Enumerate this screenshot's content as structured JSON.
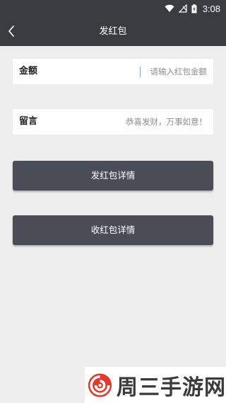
{
  "status_bar": {
    "time": "3:08",
    "icons": [
      "wifi-icon",
      "no-signal-icon",
      "battery-charging-icon"
    ]
  },
  "nav": {
    "title": "发红包",
    "back_icon": "chevron-left-icon"
  },
  "amount_field": {
    "label": "金额",
    "placeholder": "请输入红包金额",
    "value": ""
  },
  "message_field": {
    "label": "留言",
    "placeholder": "恭喜发财，万事如意！",
    "value": ""
  },
  "buttons": {
    "send_details": "发红包详情",
    "receive_details": "收红包详情"
  },
  "watermark": {
    "text": "周三手游网"
  },
  "colors": {
    "bar_background": "#3a3c42",
    "page_background": "#ededed",
    "button_background": "#4a4d55",
    "logo_red": "#e8382c"
  }
}
